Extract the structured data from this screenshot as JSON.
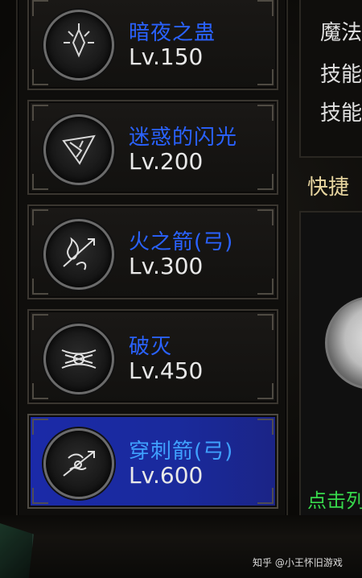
{
  "skills": [
    {
      "name": "暗夜之蛊",
      "level": "Lv.150",
      "icon": "poison-icon"
    },
    {
      "name": "迷惑的闪光",
      "level": "Lv.200",
      "icon": "flash-icon"
    },
    {
      "name": "火之箭(弓)",
      "level": "Lv.300",
      "icon": "fire-arrow-icon"
    },
    {
      "name": "破灭",
      "level": "Lv.450",
      "icon": "ruin-icon"
    },
    {
      "name": "穿刺箭(弓)",
      "level": "Lv.600",
      "icon": "pierce-arrow-icon"
    }
  ],
  "right_panel": {
    "lines": [
      "魔法",
      "技能",
      "技能"
    ]
  },
  "shortcut": {
    "title": "快捷",
    "hint": "点击列"
  },
  "watermark": "知乎 @小王怀旧游戏",
  "colors": {
    "skill_name": "#2a62ff",
    "selected_bg": "#1b2aa8",
    "hint_green": "#37d94c"
  }
}
